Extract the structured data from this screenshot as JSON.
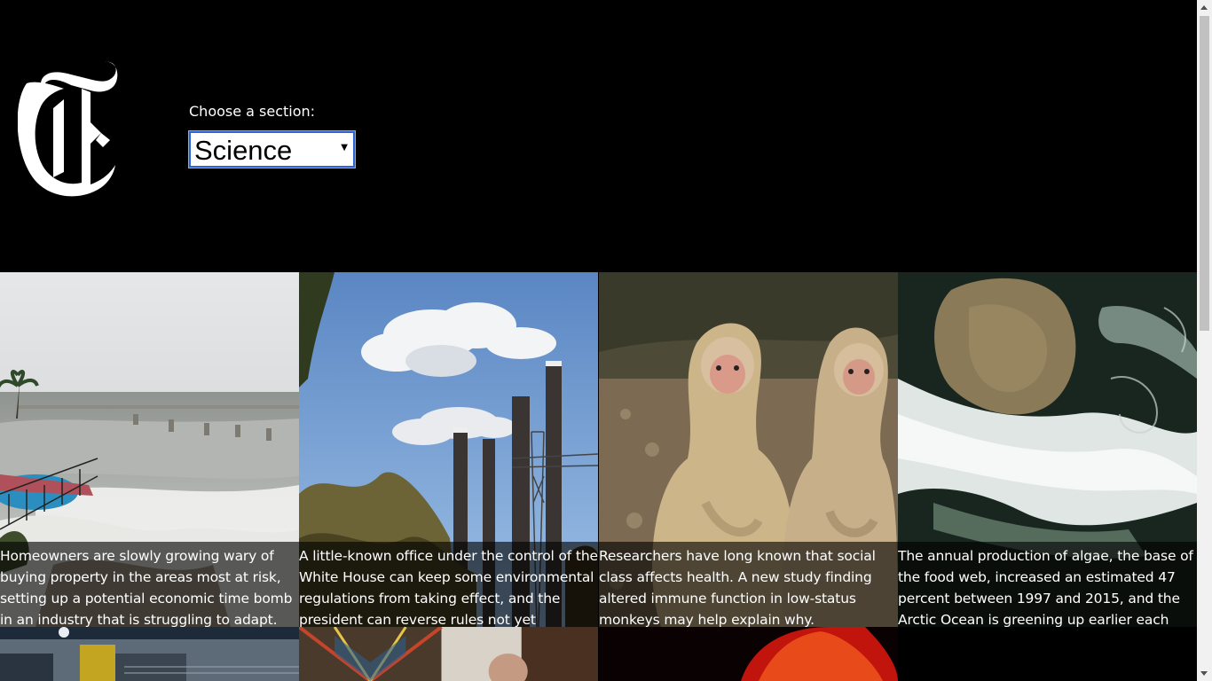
{
  "header": {
    "logo_name": "nyt-t-logo",
    "section_label": "Choose a section:",
    "section_select_value": "Science"
  },
  "articles": [
    {
      "abstract": "Homeowners are slowly growing wary of buying property in the areas most at risk, setting up a potential economic time bomb in an industry that is struggling to adapt."
    },
    {
      "abstract": "A little-known office under the control of the White House can keep some environmental regulations from taking effect, and the president can reverse rules not yet completed."
    },
    {
      "abstract": "Researchers have long known that social class affects health. A new study finding altered immune function in low-status monkeys may help explain why."
    },
    {
      "abstract": "The annual production of algae, the base of the food web, increased an estimated 47 percent between 1997 and 2015, and the Arctic Ocean is greening up earlier each year."
    }
  ],
  "colors": {
    "background": "#000000",
    "caption_overlay": "rgba(0,0,0,0.62)",
    "select_border": "#2a64d8",
    "scrollbar_track": "#f1f1f1",
    "scrollbar_thumb": "#c1c1c1"
  }
}
